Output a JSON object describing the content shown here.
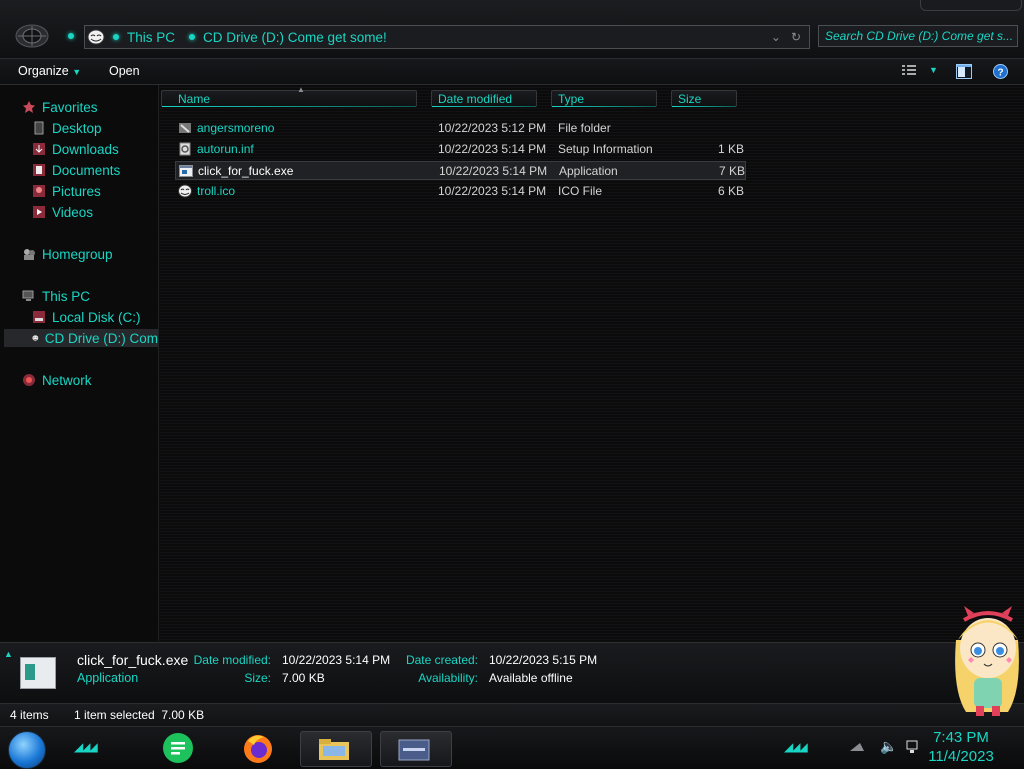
{
  "address": {
    "crumbs": [
      "This PC",
      "CD Drive (D:) Come get some!"
    ]
  },
  "search": {
    "placeholder": "Search CD Drive (D:) Come get s..."
  },
  "toolbar": {
    "organize_label": "Organize",
    "open_label": "Open"
  },
  "nav": {
    "favorites": "Favorites",
    "desktop": "Desktop",
    "downloads": "Downloads",
    "documents": "Documents",
    "pictures": "Pictures",
    "videos": "Videos",
    "homegroup": "Homegroup",
    "this_pc": "This PC",
    "local_disk": "Local Disk (C:)",
    "cd_drive": "CD Drive (D:) Com",
    "network": "Network"
  },
  "columns": {
    "name": "Name",
    "date": "Date modified",
    "type": "Type",
    "size": "Size"
  },
  "files": [
    {
      "name": "angersmoreno",
      "date": "10/22/2023 5:12 PM",
      "type": "File folder",
      "size": ""
    },
    {
      "name": "autorun.inf",
      "date": "10/22/2023 5:14 PM",
      "type": "Setup Information",
      "size": "1 KB"
    },
    {
      "name": "click_for_fuck.exe",
      "date": "10/22/2023 5:14 PM",
      "type": "Application",
      "size": "7 KB"
    },
    {
      "name": "troll.ico",
      "date": "10/22/2023 5:14 PM",
      "type": "ICO File",
      "size": "6 KB"
    }
  ],
  "details": {
    "name": "click_for_fuck.exe",
    "kind": "Application",
    "date_modified_label": "Date modified:",
    "date_modified": "10/22/2023 5:14 PM",
    "size_label": "Size:",
    "size": "7.00 KB",
    "date_created_label": "Date created:",
    "date_created": "10/22/2023 5:15 PM",
    "availability_label": "Availability:",
    "availability": "Available offline"
  },
  "status": {
    "items": "4 items",
    "selected": "1 item selected  7.00 KB"
  },
  "clock": {
    "time": "7:43 PM",
    "date": "11/4/2023"
  },
  "colors": {
    "accent": "#19d6c4",
    "background": "#0c0c0d"
  }
}
